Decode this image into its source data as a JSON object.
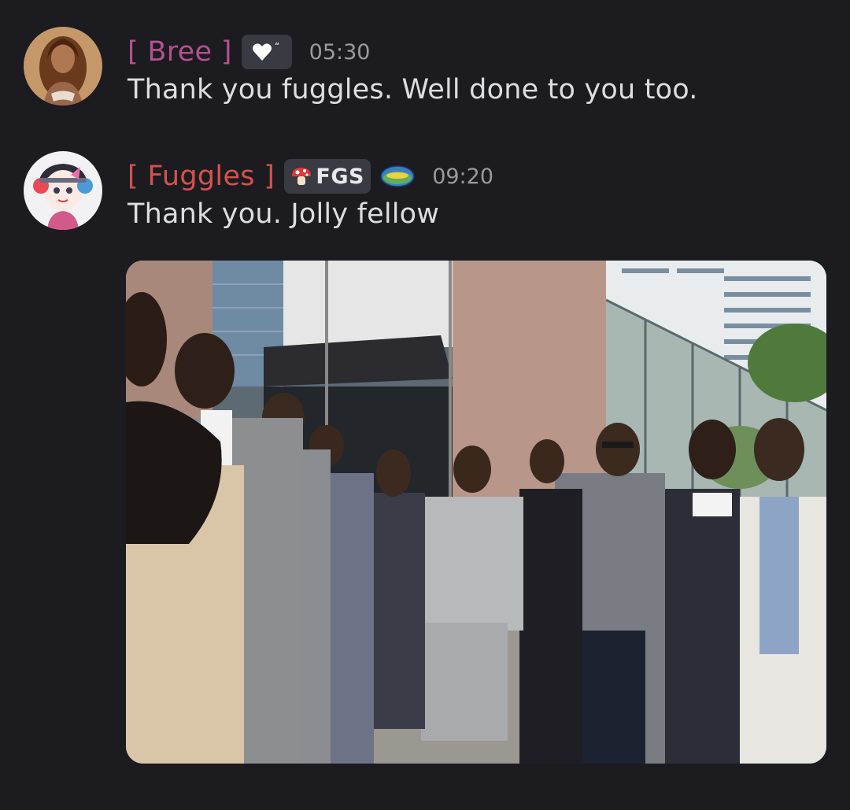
{
  "messages": [
    {
      "username": "[ Bree ]",
      "timestamp": "05:30",
      "text": "Thank you fuggles. Well done to you too.",
      "name_color": "#b4518f",
      "badge_icon": "heart-quote-icon"
    },
    {
      "username": "[ Fuggles ]",
      "timestamp": "09:20",
      "text": "Thank you. Jolly fellow",
      "name_color": "#d4524e",
      "tag": "FGS",
      "tag_icon": "mushroom-icon",
      "extra_badge_icon": "server-emblem-icon"
    }
  ],
  "attachment": {
    "type": "video-gif",
    "subject": "group of men in suits standing outside a glass office building"
  },
  "colors": {
    "background": "#1b1b20",
    "text": "#dcdde2",
    "timestamp": "#9a9aa2",
    "badge_bg": "#3a3a42"
  }
}
